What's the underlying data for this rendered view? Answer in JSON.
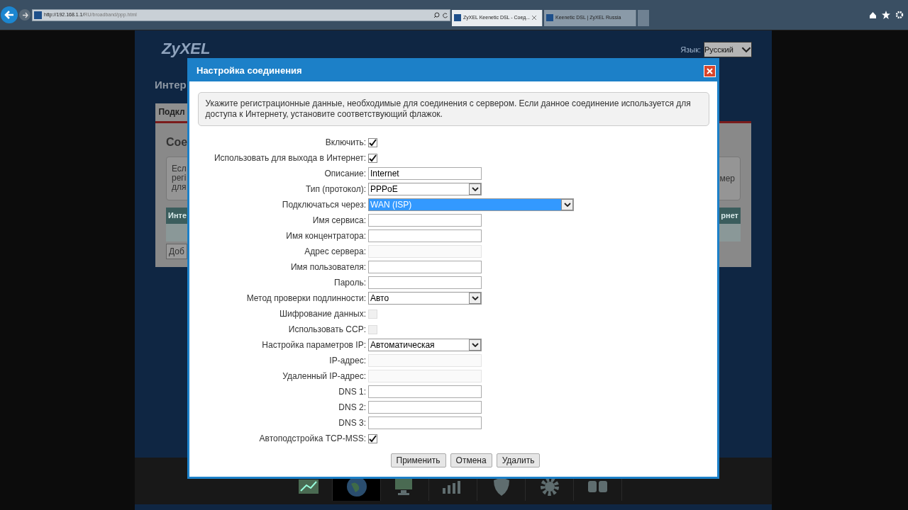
{
  "browser": {
    "url_host": "http://192.168.1.1/",
    "url_path": "RU/broadband/ppp.html",
    "tabs": [
      {
        "label": "ZyXEL Keenetic DSL - Соед...",
        "selected": true,
        "closable": true
      },
      {
        "label": "Keenetic DSL | ZyXEL Russia",
        "selected": false,
        "closable": false
      }
    ]
  },
  "page": {
    "logo": "ZyXEL",
    "language_label": "Язык:",
    "language": "Русский",
    "title": "Интер",
    "tab": "Подкл",
    "section_title": "Сое",
    "info_left": [
      "Есл",
      "регі",
      "для"
    ],
    "info_right": "мер",
    "table_col_1": "Инте",
    "table_col_2": "рнет",
    "add_button": "Доб",
    "dock": [
      {
        "kind": "chart",
        "selected": false
      },
      {
        "kind": "globe",
        "selected": true
      },
      {
        "kind": "computer",
        "selected": false
      },
      {
        "kind": "signal",
        "selected": false
      },
      {
        "kind": "shield",
        "selected": false
      },
      {
        "kind": "gear",
        "selected": false
      },
      {
        "kind": "apps",
        "selected": false
      }
    ]
  },
  "dialog": {
    "title": "Настройка соединения",
    "info": "Укажите регистрационные данные, необходимые для соединения с сервером. Если данное соединение используется для доступа к Интернету, установите соответствующий флажок.",
    "fields": [
      {
        "kind": "checkbox",
        "label": "Включить:",
        "checked": true,
        "disabled": false
      },
      {
        "kind": "checkbox",
        "label": "Использовать для выхода в Интернет:",
        "checked": true,
        "disabled": false
      },
      {
        "kind": "text",
        "label": "Описание:",
        "value": "Internet",
        "disabled": false
      },
      {
        "kind": "select",
        "label": "Тип (протокол):",
        "value": "PPPoE",
        "selected": false,
        "wide": false
      },
      {
        "kind": "select",
        "label": "Подключаться через:",
        "value": "WAN (ISP)",
        "selected": true,
        "wide": true
      },
      {
        "kind": "text",
        "label": "Имя сервиса:",
        "disabled": false
      },
      {
        "kind": "text",
        "label": "Имя концентратора:",
        "disabled": false
      },
      {
        "kind": "text",
        "label": "Адрес сервера:",
        "disabled": true
      },
      {
        "kind": "text",
        "label": "Имя пользователя:",
        "disabled": false
      },
      {
        "kind": "text",
        "label": "Пароль:",
        "disabled": false
      },
      {
        "kind": "select",
        "label": "Метод проверки подлинности:",
        "value": "Авто",
        "selected": false,
        "wide": false
      },
      {
        "kind": "checkbox",
        "label": "Шифрование данных:",
        "checked": false,
        "disabled": true
      },
      {
        "kind": "checkbox",
        "label": "Использовать CCP:",
        "checked": false,
        "disabled": true
      },
      {
        "kind": "select",
        "label": "Настройка параметров IP:",
        "value": "Автоматическая",
        "selected": false,
        "wide": false
      },
      {
        "kind": "text",
        "label": "IP-адрес:",
        "disabled": true
      },
      {
        "kind": "text",
        "label": "Удаленный IP-адрес:",
        "disabled": true
      },
      {
        "kind": "text",
        "label": "DNS 1:",
        "disabled": false
      },
      {
        "kind": "text",
        "label": "DNS 2:",
        "disabled": false
      },
      {
        "kind": "text",
        "label": "DNS 3:",
        "disabled": false
      },
      {
        "kind": "checkbox",
        "label": "Автоподстройка TCP-MSS:",
        "checked": true,
        "disabled": false
      }
    ],
    "buttons": [
      "Применить",
      "Отмена",
      "Удалить"
    ]
  }
}
